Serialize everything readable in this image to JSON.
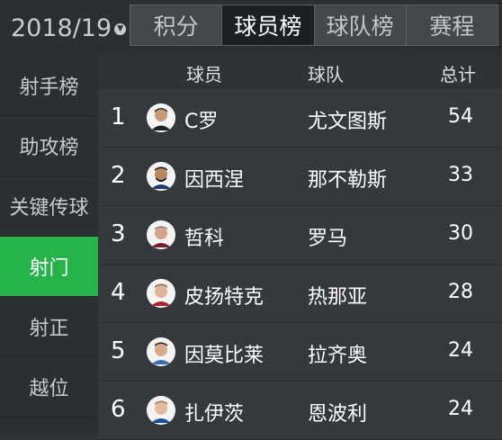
{
  "header": {
    "season": "2018/19",
    "tabs": [
      {
        "label": "积分",
        "active": false
      },
      {
        "label": "球员榜",
        "active": true
      },
      {
        "label": "球队榜",
        "active": false
      },
      {
        "label": "赛程",
        "active": false
      }
    ]
  },
  "sidebar": {
    "items": [
      {
        "label": "射手榜",
        "active": false
      },
      {
        "label": "助攻榜",
        "active": false
      },
      {
        "label": "关键传球",
        "active": false
      },
      {
        "label": "射门",
        "active": true
      },
      {
        "label": "射正",
        "active": false
      },
      {
        "label": "越位",
        "active": false
      }
    ]
  },
  "table": {
    "columns": {
      "player": "球员",
      "team": "球队",
      "total": "总计"
    },
    "rows": [
      {
        "rank": "1",
        "player": "C罗",
        "team": "尤文图斯",
        "total": "54"
      },
      {
        "rank": "2",
        "player": "因西涅",
        "team": "那不勒斯",
        "total": "33"
      },
      {
        "rank": "3",
        "player": "哲科",
        "team": "罗马",
        "total": "30"
      },
      {
        "rank": "4",
        "player": "皮扬特克",
        "team": "热那亚",
        "total": "28"
      },
      {
        "rank": "5",
        "player": "因莫比莱",
        "team": "拉齐奥",
        "total": "24"
      },
      {
        "rank": "6",
        "player": "扎伊茨",
        "team": "恩波利",
        "total": "24"
      }
    ]
  },
  "colors": {
    "accent": "#26b34a",
    "background": "#2f3337",
    "active_tab": "#1d2023"
  }
}
